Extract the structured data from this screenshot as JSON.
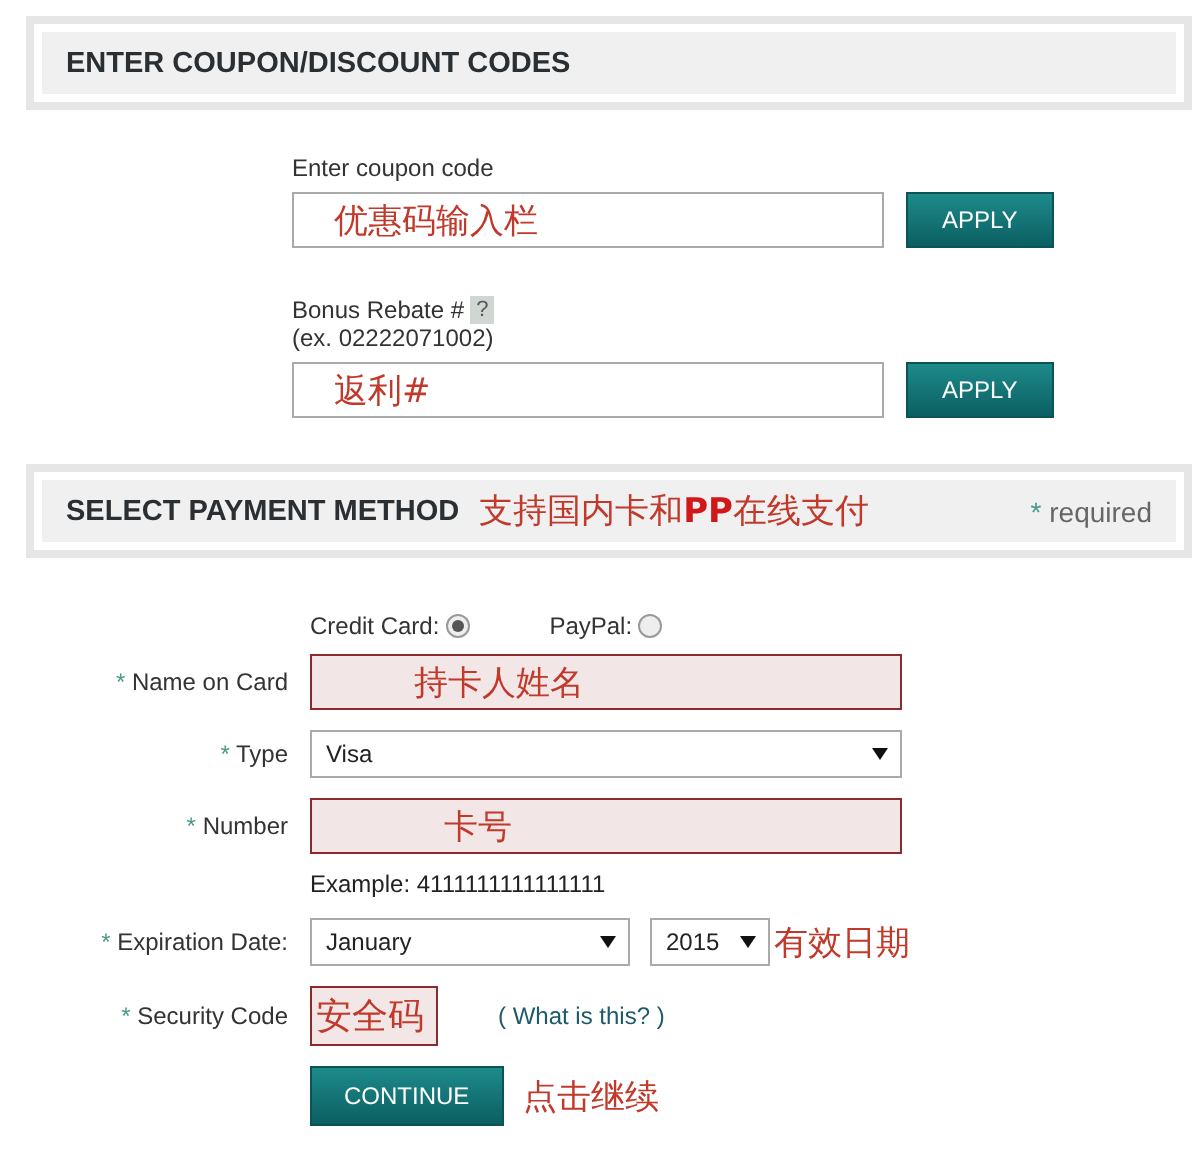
{
  "coupon_section": {
    "title": "ENTER COUPON/DISCOUNT CODES"
  },
  "coupon_fields": [
    {
      "label": "Enter coupon code",
      "annotation": "优惠码输入栏",
      "button": "APPLY"
    },
    {
      "label": "Bonus Rebate #",
      "help_text": "?",
      "hint": "(ex. 02222071002)",
      "annotation": "返利#",
      "button": "APPLY"
    }
  ],
  "payment_section": {
    "title": "SELECT PAYMENT METHOD",
    "annotation": "支持国内卡和**PP**在线支付",
    "required_mark": "*",
    "required_note": "required"
  },
  "methods": [
    {
      "label": "Credit Card:",
      "selected": true
    },
    {
      "label": "PayPal:",
      "selected": false
    }
  ],
  "form_rows": [
    {
      "kind": "input",
      "mark": "*",
      "label": "Name on Card",
      "error": true,
      "annotation": "持卡人姓名"
    },
    {
      "kind": "select",
      "mark": "*",
      "label": "Type",
      "value": "Visa"
    },
    {
      "kind": "input",
      "mark": "*",
      "label": "Number",
      "error": true,
      "annotation": "卡号",
      "example": "Example: 4111111111111111"
    },
    {
      "kind": "date",
      "mark": "*",
      "label": "Expiration Date:",
      "month": "January",
      "year": "2015",
      "annotation": "有效日期"
    },
    {
      "kind": "security",
      "mark": "*",
      "label": "Security Code",
      "error": true,
      "annotation": "安全码",
      "link": "( What is this? )"
    }
  ],
  "continue": {
    "button": "CONTINUE",
    "annotation": "点击继续"
  }
}
